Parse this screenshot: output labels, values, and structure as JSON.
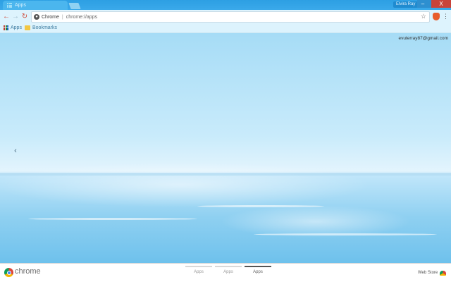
{
  "window": {
    "tab_title": "Apps",
    "profile_name": "Elvira Ray",
    "controls": {
      "minimize": "–",
      "maximize": "▫",
      "close": "X"
    }
  },
  "toolbar": {
    "back": "←",
    "forward": "→",
    "reload": "↻",
    "omnibox": {
      "chip_label": "Chrome",
      "separator": "|",
      "url": "chrome://apps"
    },
    "star": "☆",
    "menu": "⋮"
  },
  "bookmarks": {
    "items": [
      {
        "label": "Apps",
        "icon": "apps-grid-icon"
      },
      {
        "label": "Bookmarks",
        "icon": "folder-icon"
      }
    ]
  },
  "content": {
    "user_email": "evuterray87@gmail.com",
    "prev_arrow": "‹"
  },
  "footer": {
    "brand": "chrome",
    "pages": [
      {
        "label": "Apps",
        "active": false
      },
      {
        "label": "Apps",
        "active": false
      },
      {
        "label": "Apps",
        "active": true
      }
    ],
    "webstore_label": "Web Store"
  },
  "colors": {
    "titlebar": "#2d9fe3",
    "toolbar": "#ddf3fd",
    "close_button": "#c9433a",
    "sky": "#a6dcf6",
    "snow": "#6ec1ec"
  }
}
